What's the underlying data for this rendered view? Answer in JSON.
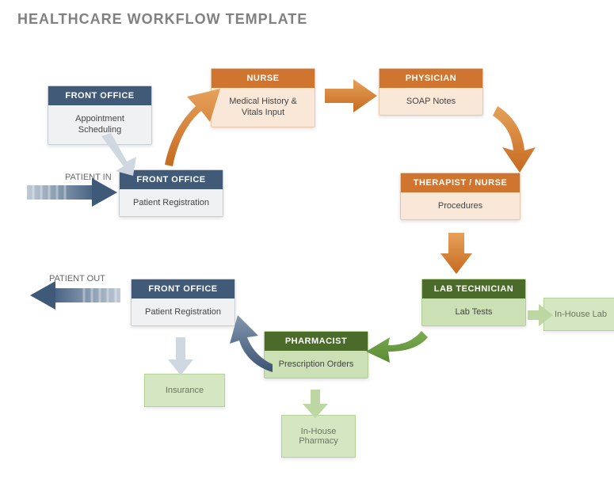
{
  "title": "HEALTHCARE WORKFLOW TEMPLATE",
  "labels": {
    "patient_in": "PATIENT IN",
    "patient_out": "PATIENT OUT"
  },
  "cards": {
    "fo_appt": {
      "role": "FRONT OFFICE",
      "task": "Appointment Scheduling"
    },
    "fo_reg1": {
      "role": "FRONT OFFICE",
      "task": "Patient Registration"
    },
    "nurse": {
      "role": "NURSE",
      "task": "Medical History & Vitals Input"
    },
    "physician": {
      "role": "PHYSICIAN",
      "task": "SOAP Notes"
    },
    "therapist_nurse": {
      "role": "THERAPIST / NURSE",
      "task": "Procedures"
    },
    "lab": {
      "role": "LAB TECHNICIAN",
      "task": "Lab Tests"
    },
    "pharmacist": {
      "role": "PHARMACIST",
      "task": "Prescription Orders"
    },
    "fo_reg2": {
      "role": "FRONT OFFICE",
      "task": "Patient Registration"
    }
  },
  "aux": {
    "insurance": "Insurance",
    "inhouse_pharmacy": "In-House Pharmacy",
    "inhouse_lab": "In-House Lab"
  },
  "flow_description": {
    "entry": "PATIENT IN arrow leads into Front Office Patient Registration",
    "exit": "PATIENT OUT arrow leads out from Front Office Patient Registration (second)",
    "edges": [
      {
        "from": "fo_appt",
        "to": "fo_reg1",
        "style": "light-blue-small"
      },
      {
        "from": "fo_reg1",
        "to": "nurse",
        "style": "orange-curve"
      },
      {
        "from": "nurse",
        "to": "physician",
        "style": "orange-block"
      },
      {
        "from": "physician",
        "to": "therapist_nurse",
        "style": "orange-curve"
      },
      {
        "from": "therapist_nurse",
        "to": "lab",
        "style": "orange-block-small"
      },
      {
        "from": "lab",
        "to": "pharmacist",
        "style": "green-curve"
      },
      {
        "from": "pharmacist",
        "to": "fo_reg2",
        "style": "blue-curve"
      },
      {
        "from": "fo_reg2",
        "to": "insurance",
        "style": "light-blue-small"
      },
      {
        "from": "lab",
        "to": "inhouse_lab",
        "style": "light-green-small"
      },
      {
        "from": "pharmacist",
        "to": "inhouse_pharmacy",
        "style": "light-green-small"
      }
    ]
  }
}
